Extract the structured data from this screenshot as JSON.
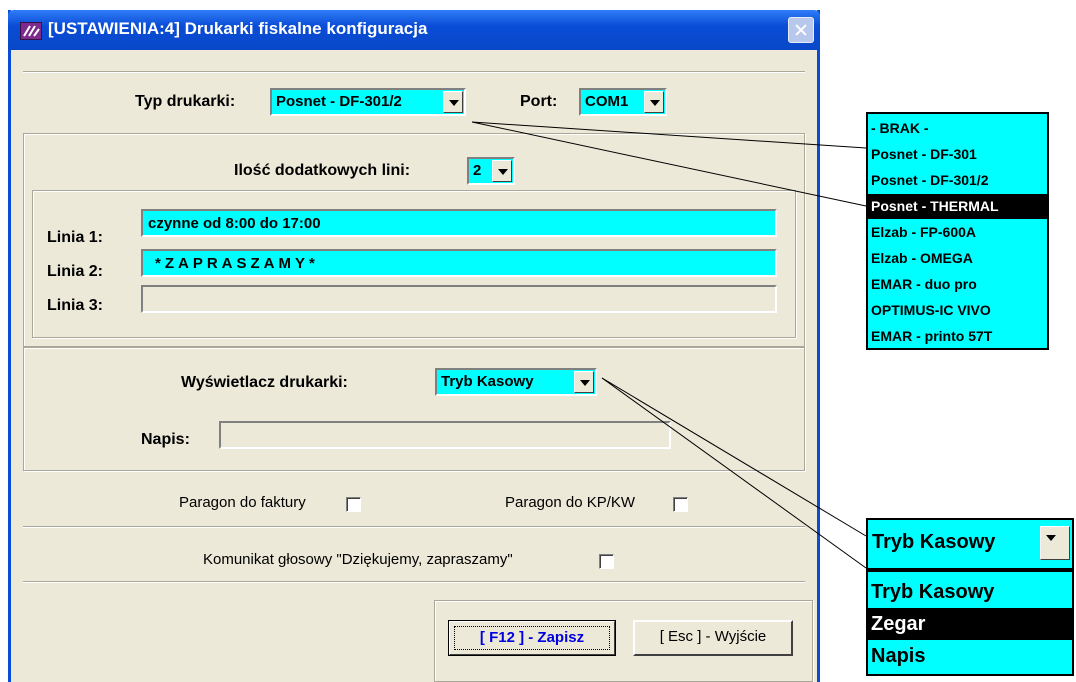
{
  "window": {
    "title": "[USTAWIENIA:4]  Drukarki fiskalne konfiguracja"
  },
  "printer": {
    "type_label": "Typ drukarki:",
    "type_value": "Posnet - DF-301/2",
    "port_label": "Port:",
    "port_value": "COM1"
  },
  "extra_lines": {
    "count_label": "Ilość dodatkowych lini:",
    "count_value": "2",
    "lines": [
      {
        "label": "Linia 1:",
        "value": "czynne od 8:00 do 17:00"
      },
      {
        "label": "Linia 2:",
        "value": "*ZAPRASZAMY*"
      },
      {
        "label": "Linia 3:",
        "value": ""
      }
    ]
  },
  "display": {
    "label": "Wyświetlacz drukarki:",
    "value": "Tryb Kasowy",
    "napis_label": "Napis:",
    "napis_value": ""
  },
  "options": {
    "paragon_faktury": "Paragon do faktury",
    "paragon_kpkw": "Paragon do KP/KW",
    "komunikat": "Komunikat głosowy \"Dziękujemy, zapraszamy\""
  },
  "buttons": {
    "save": "[ F12 ] - Zapisz",
    "exit": "[ Esc ] - Wyjście"
  },
  "printer_dropdown": {
    "items": [
      "- BRAK -",
      "Posnet - DF-301",
      "Posnet - DF-301/2",
      "Posnet - THERMAL",
      "Elzab - FP-600A",
      "Elzab - OMEGA",
      "EMAR - duo pro",
      "OPTIMUS-IC VIVO",
      "EMAR - printo 57T"
    ],
    "selected_index": 3
  },
  "display_dropdown": {
    "current": "Tryb Kasowy",
    "items": [
      "Tryb Kasowy",
      "Zegar",
      "Napis"
    ],
    "selected_index": 1
  },
  "colors": {
    "field_bg": "#00ffff",
    "title_bar": "#0a4cd6",
    "window_bg": "#ece9d8",
    "save_text": "#0000e0"
  }
}
